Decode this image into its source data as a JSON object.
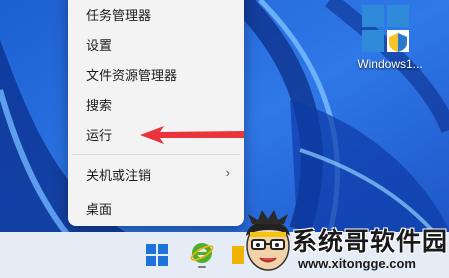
{
  "context_menu": {
    "items": [
      {
        "label": "任务管理器"
      },
      {
        "label": "设置"
      },
      {
        "label": "文件资源管理器"
      },
      {
        "label": "搜索"
      },
      {
        "label": "运行"
      },
      {
        "label": "关机或注销"
      },
      {
        "label": "桌面"
      }
    ]
  },
  "desktop_icon": {
    "label": "Windows1..."
  },
  "watermark": {
    "title": "系统哥软件园",
    "url": "www.xitongge.com"
  },
  "colors": {
    "arrow": "#e8343a",
    "menu_bg": "#f3f3f3",
    "wallpaper": "#2a6fd6"
  }
}
